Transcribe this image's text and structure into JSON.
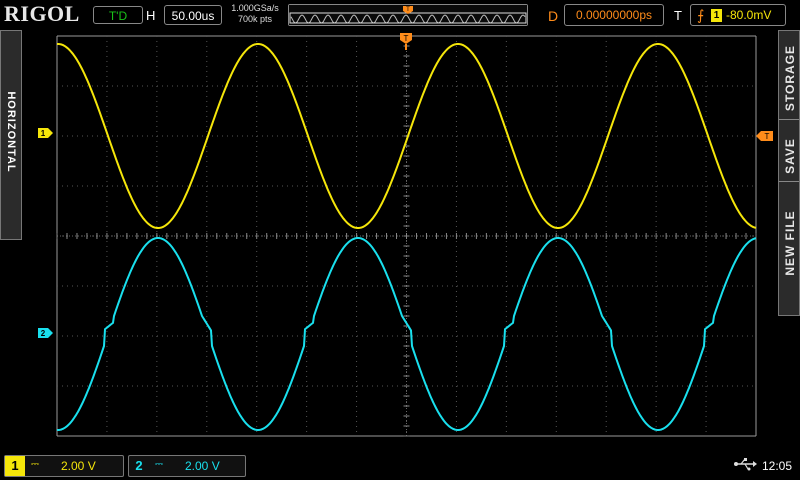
{
  "header": {
    "logo": "RIGOL",
    "run_status": "T'D",
    "horizontal_label": "H",
    "timebase": "50.00us",
    "sample_rate": "1.000GSa/s",
    "memory_depth": "700k pts",
    "delay_label": "D",
    "trigger_delay": "0.00000000ps",
    "trigger_label": "T",
    "trigger_level": "-80.0mV"
  },
  "left_tab": {
    "label": "HORIZONTAL"
  },
  "right_menu": {
    "items": [
      "STORAGE",
      "SAVE",
      "NEW FILE"
    ]
  },
  "markers": {
    "ch1": "1",
    "ch2": "2",
    "trigger": "T"
  },
  "channels": [
    {
      "number": "1",
      "coupling": "⎓",
      "scale": "2.00 V",
      "color": "#f5e60a"
    },
    {
      "number": "2",
      "coupling": "⎓",
      "scale": "2.00 V",
      "color": "#19e0ee"
    }
  ],
  "status": {
    "clock": "12:05",
    "usb_icon": "usb-icon"
  },
  "colors": {
    "ch1": "#f5e60a",
    "ch2": "#19e0ee",
    "trigger": "#ff8c1a",
    "run": "#19c219"
  }
}
